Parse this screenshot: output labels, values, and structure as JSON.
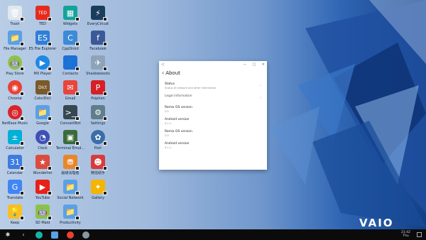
{
  "wallpaper": {
    "brand_text": "VAIO"
  },
  "desktop": {
    "icons": [
      {
        "label": "Trash",
        "icon": "trash-icon",
        "color": "#dfe7ef",
        "glyph": "🗑"
      },
      {
        "label": "TED",
        "icon": "ted-icon",
        "color": "#e62b1e",
        "glyph": "TED"
      },
      {
        "label": "Widgets",
        "icon": "widgets-icon",
        "color": "#14a39a",
        "glyph": "▦"
      },
      {
        "label": "EveryCircuit",
        "icon": "everycircuit-icon",
        "color": "#1a3d5c",
        "glyph": "⚡"
      },
      {
        "label": "File Manager",
        "icon": "folder-icon",
        "color": "#5aa0e6",
        "glyph": "📁"
      },
      {
        "label": "ES File Explorer",
        "icon": "es-explorer-icon",
        "color": "#2f7fd6",
        "glyph": "ES"
      },
      {
        "label": "CppDroid",
        "icon": "cppdroid-icon",
        "color": "#3d8ad8",
        "glyph": "C"
      },
      {
        "label": "Facebook",
        "icon": "facebook-icon",
        "color": "#3b5998",
        "glyph": "f"
      },
      {
        "label": "Play Store",
        "icon": "play-store-icon",
        "color": "#8bc34a",
        "glyph": "🤖"
      },
      {
        "label": "MX Player",
        "icon": "mx-player-icon",
        "color": "#1e88e5",
        "glyph": "▶"
      },
      {
        "label": "Contacts",
        "icon": "contacts-icon",
        "color": "#1e6fd6",
        "glyph": "👤"
      },
      {
        "label": "Shadowsocks",
        "icon": "shadowsocks-icon",
        "color": "#8fa3b8",
        "glyph": "✈"
      },
      {
        "label": "Chrome",
        "icon": "chrome-icon",
        "color": "#e94235",
        "glyph": "◉"
      },
      {
        "label": "ColorDict",
        "icon": "colordict-icon",
        "color": "#7a5a2a",
        "glyph": "Dict"
      },
      {
        "label": "Gmail",
        "icon": "gmail-icon",
        "color": "#e8453c",
        "glyph": "✉"
      },
      {
        "label": "Psiphon",
        "icon": "psiphon-icon",
        "color": "#d61f26",
        "glyph": "P"
      },
      {
        "label": "NetEase Music",
        "icon": "netease-music-icon",
        "color": "#d8242a",
        "glyph": "◎"
      },
      {
        "label": "Google",
        "icon": "google-folder-icon",
        "color": "#5aa0e6",
        "glyph": "📁"
      },
      {
        "label": "ConnectBot",
        "icon": "connectbot-icon",
        "color": "#37474f",
        "glyph": ">_"
      },
      {
        "label": "Settings",
        "icon": "settings-icon",
        "color": "#607d8b",
        "glyph": "⚙"
      },
      {
        "label": "Calculator",
        "icon": "calculator-icon",
        "color": "#00b0d7",
        "glyph": "±"
      },
      {
        "label": "Clock",
        "icon": "clock-icon",
        "color": "#3f51b5",
        "glyph": "◔"
      },
      {
        "label": "Terminal Emul...",
        "icon": "terminal-icon",
        "color": "#3a6b3a",
        "glyph": "▣"
      },
      {
        "label": "Pixlr",
        "icon": "pixlr-icon",
        "color": "#3a6ea8",
        "glyph": "✿"
      },
      {
        "label": "Calendar",
        "icon": "calendar-icon",
        "color": "#3d7be0",
        "glyph": "31"
      },
      {
        "label": "Wunderlist",
        "icon": "wunderlist-icon",
        "color": "#db4c3f",
        "glyph": "★"
      },
      {
        "label": "超级清理者",
        "icon": "cleaner-icon",
        "color": "#e8862c",
        "glyph": "⛃"
      },
      {
        "label": "微信助手",
        "icon": "wechat-helper-icon",
        "color": "#d83b3b",
        "glyph": "☻"
      },
      {
        "label": "Translate",
        "icon": "translate-icon",
        "color": "#4285f4",
        "glyph": "G"
      },
      {
        "label": "YouTube",
        "icon": "youtube-icon",
        "color": "#e62117",
        "glyph": "▶"
      },
      {
        "label": "Social Network",
        "icon": "social-folder-icon",
        "color": "#5aa0e6",
        "glyph": "📁"
      },
      {
        "label": "Gallery",
        "icon": "gallery-icon",
        "color": "#f4b400",
        "glyph": "✦"
      },
      {
        "label": "Keep",
        "icon": "keep-icon",
        "color": "#f6bf26",
        "glyph": "💡"
      },
      {
        "label": "SD Maid",
        "icon": "sd-maid-icon",
        "color": "#8bc34a",
        "glyph": "🤖"
      },
      {
        "label": "Productivity",
        "icon": "productivity-folder-icon",
        "color": "#5aa0e6",
        "glyph": "📁"
      }
    ]
  },
  "window": {
    "title_icon": "◁",
    "controls": [
      "−",
      "□",
      "✕"
    ],
    "back_glyph": "‹",
    "title": "About",
    "items": [
      {
        "title": "Status",
        "subtitle": "Status of network and other information",
        "chevron": true
      },
      {
        "title": "Legal information",
        "subtitle": "",
        "chevron": true
      },
      {
        "title": "Remix OS version",
        "subtitle": "2.0",
        "chevron": false
      },
      {
        "title": "Android version",
        "subtitle": "5.1.1",
        "chevron": false
      },
      {
        "title": "Remix OS version",
        "subtitle": "2.0",
        "chevron": false
      },
      {
        "title": "Android version",
        "subtitle": "5.1.1",
        "chevron": false
      }
    ]
  },
  "taskbar": {
    "start_glyph": "✱",
    "back_glyph": "‹",
    "apps": [
      {
        "icon": "circle-app-icon",
        "color": "#16b3a7"
      },
      {
        "icon": "files-taskbar-icon",
        "color": "#5aa0e6"
      },
      {
        "icon": "chrome-taskbar-icon",
        "color": "#e94235"
      },
      {
        "icon": "settings-taskbar-icon",
        "color": "#8a96a0"
      }
    ],
    "clock_time": "21:42",
    "clock_day": "Thu"
  }
}
